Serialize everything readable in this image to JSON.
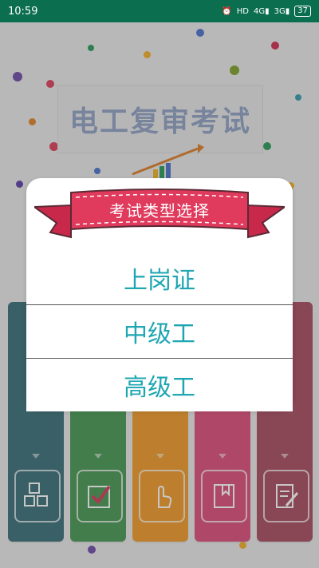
{
  "status_bar": {
    "time": "10:59",
    "icons": [
      "alarm-icon",
      "hd-icon",
      "4g-signal-icon",
      "3g-signal-icon",
      "battery-icon"
    ],
    "net_4g": "4G",
    "net_3g": "3G",
    "hd": "HD",
    "battery": "37"
  },
  "colors": {
    "status_bar": "#0b6e4f",
    "accent": "#1fa6b2",
    "ribbon": "#e03a5c",
    "book_colors": [
      "#4a7c83",
      "#56a060",
      "#f2a33a",
      "#e05d86",
      "#b05a6c"
    ]
  },
  "background": {
    "app_title": "电工复审考试",
    "book_icons": [
      "abc-blocks-icon",
      "checkbox-icon",
      "tap-hand-icon",
      "bookmark-book-icon",
      "edit-document-icon"
    ]
  },
  "dialog": {
    "title": "考试类型选择",
    "options": [
      {
        "label": "上岗证"
      },
      {
        "label": "中级工"
      },
      {
        "label": "高级工"
      }
    ]
  }
}
